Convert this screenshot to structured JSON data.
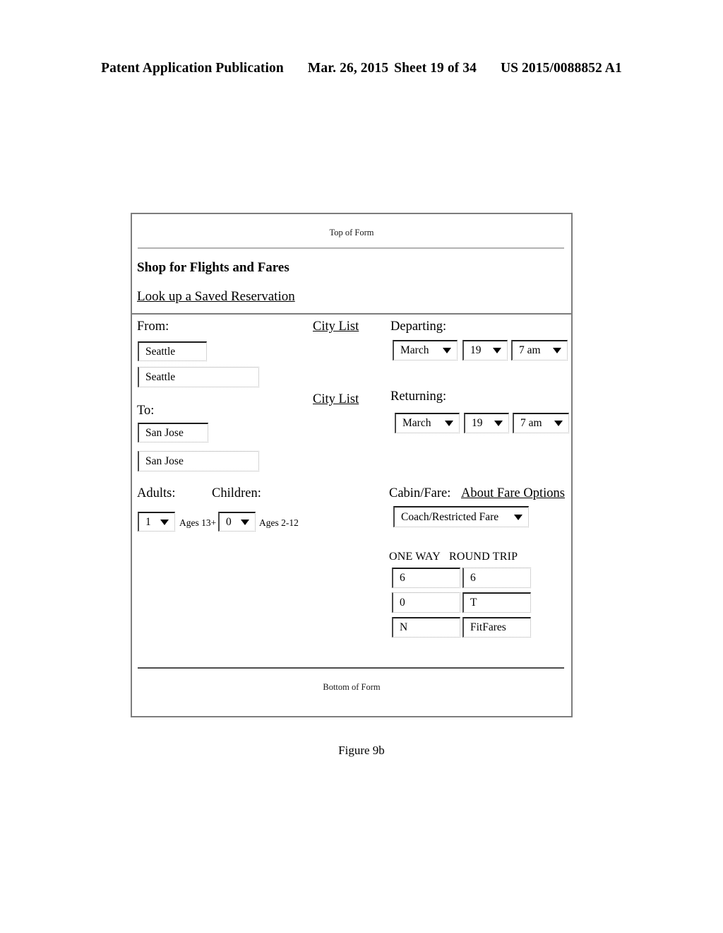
{
  "patent_header": {
    "publication": "Patent Application Publication",
    "date": "Mar. 26, 2015",
    "sheet": "Sheet 19 of 34",
    "number": "US 2015/0088852 A1"
  },
  "figure": {
    "caption": "Figure 9b"
  },
  "form": {
    "top_marker": "Top of Form",
    "bottom_marker": "Bottom of Form",
    "title": "Shop for Flights and Fares",
    "saved_reservation_link": "Look up a Saved Reservation",
    "origin": {
      "label": "From:",
      "city_list_link": "City List",
      "input_value": "Seattle",
      "suggestion_value": "Seattle"
    },
    "destination": {
      "label": "To:",
      "city_list_link": "City List",
      "input_value": "San Jose",
      "suggestion_value": "San Jose"
    },
    "departing": {
      "label": "Departing:",
      "month": "March",
      "day": "19",
      "time": "7 am"
    },
    "returning": {
      "label": "Returning:",
      "month": "March",
      "day": "19",
      "time": "7 am"
    },
    "passengers": {
      "adults_label": "Adults:",
      "adults_value": "1",
      "adults_hint": "Ages 13+",
      "children_label": "Children:",
      "children_value": "0",
      "children_hint": "Ages 2-12"
    },
    "cabin": {
      "label": "Cabin/Fare:",
      "about_link": "About Fare Options",
      "value": "Coach/Restricted Fare"
    },
    "trip_matrix": {
      "one_way_header": "ONE WAY",
      "round_trip_header": "ROUND TRIP",
      "one_way_values": [
        "6",
        "0",
        "N"
      ],
      "round_trip_values": [
        "6",
        "T",
        "FitFares"
      ]
    }
  }
}
